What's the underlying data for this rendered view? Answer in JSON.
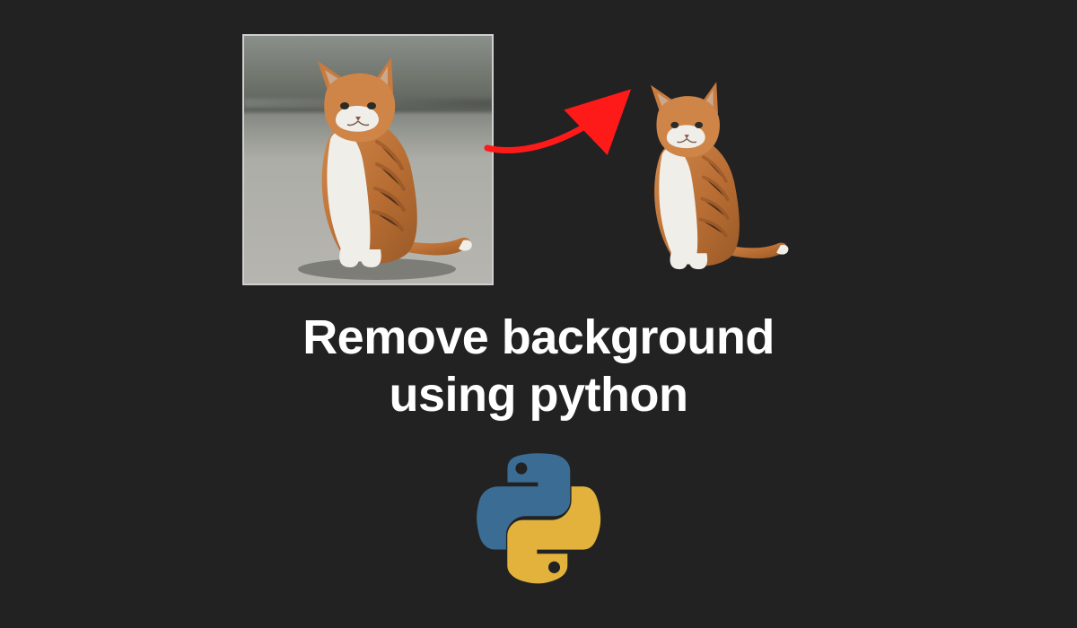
{
  "heading_line1": "Remove background",
  "heading_line2": "using python",
  "images": {
    "before_label": "cat with background",
    "after_label": "cat without background"
  },
  "arrow": {
    "color": "#ff1a1a"
  },
  "python_logo": {
    "blue": "#3b6c94",
    "yellow": "#e3b23c"
  },
  "cat_colors": {
    "orange": "#c97a3d",
    "orange_dark": "#a55f2c",
    "white": "#efeee9",
    "ear_inner": "#caa88e",
    "nose": "#8c5a49",
    "shadow": "#3a3a38"
  }
}
